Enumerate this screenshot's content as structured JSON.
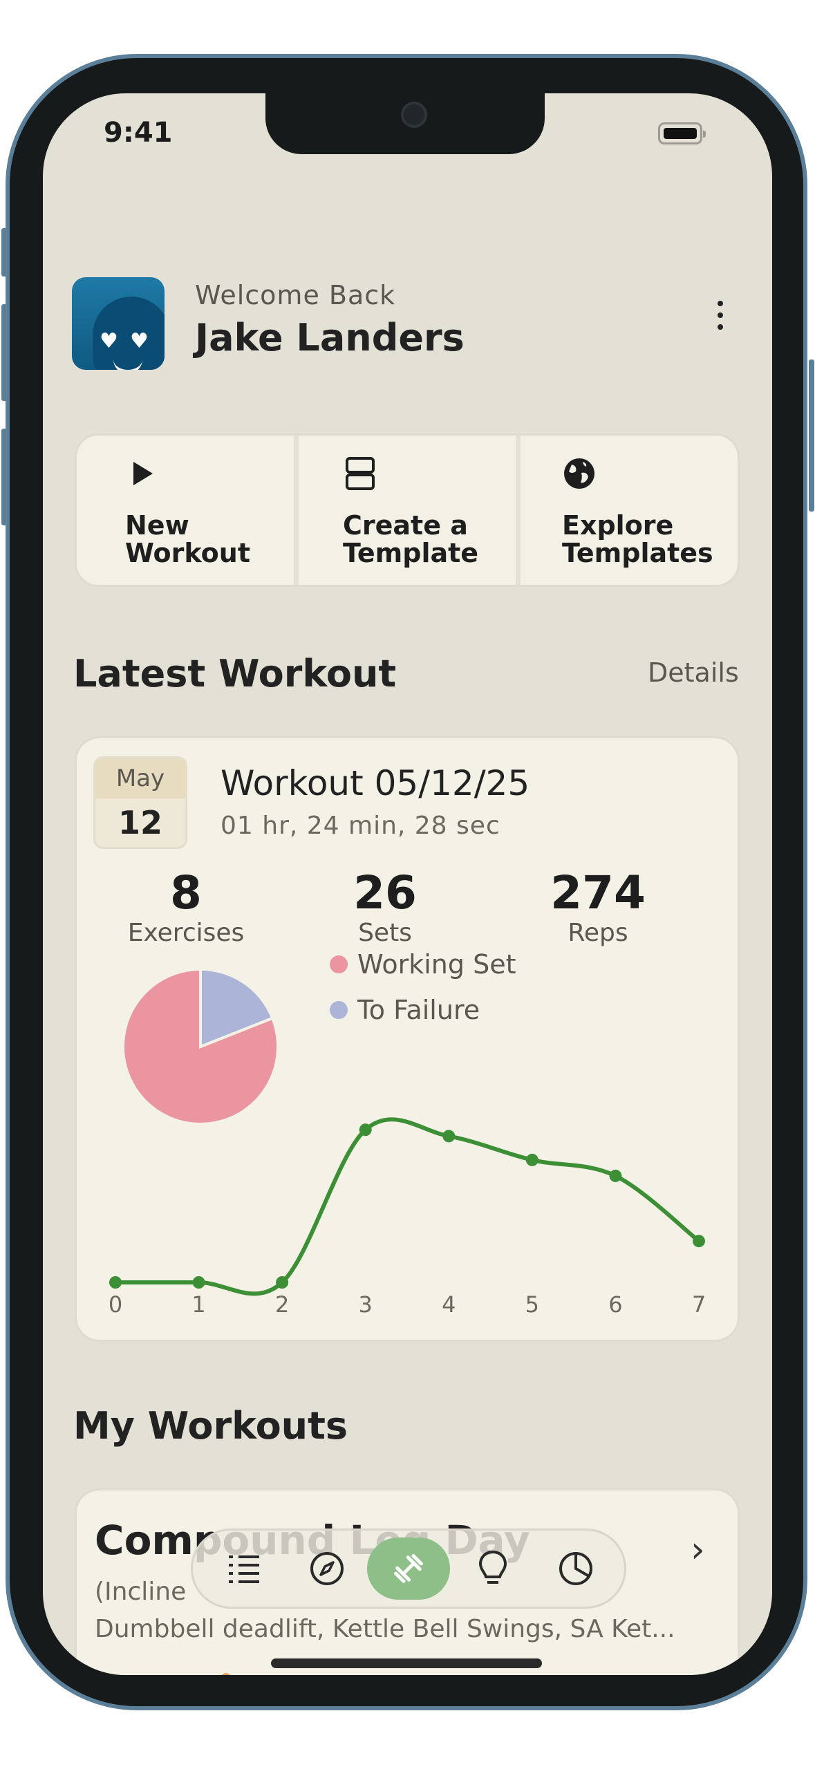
{
  "status_bar": {
    "time": "9:41"
  },
  "header": {
    "welcome": "Welcome Back",
    "name": "Jake Landers"
  },
  "quick_actions": [
    {
      "label": "New\nWorkout",
      "icon": "play-icon"
    },
    {
      "label": "Create a\nTemplate",
      "icon": "template-icon"
    },
    {
      "label": "Explore\nTemplates",
      "icon": "globe-icon"
    }
  ],
  "latest_workout": {
    "section_title": "Latest Workout",
    "details_link": "Details",
    "date_month": "May",
    "date_day": "12",
    "title": "Workout 05/12/25",
    "duration": "01 hr, 24 min, 28 sec",
    "stats": [
      {
        "value": "8",
        "label": "Exercises"
      },
      {
        "value": "26",
        "label": "Sets"
      },
      {
        "value": "274",
        "label": "Reps"
      }
    ],
    "legend": [
      {
        "label": "Working Set",
        "color": "#ea95a0"
      },
      {
        "label": "To Failure",
        "color": "#acb4d8"
      }
    ]
  },
  "chart_data": [
    {
      "type": "pie",
      "labels": [
        "Working Set",
        "To Failure"
      ],
      "values": [
        81,
        19
      ],
      "colors": [
        "#ea95a0",
        "#acb4d8"
      ]
    },
    {
      "type": "line",
      "x": [
        0,
        1,
        2,
        3,
        4,
        5,
        6,
        7
      ],
      "y": [
        0,
        0,
        0,
        0.96,
        0.92,
        0.77,
        0.67,
        0.26
      ],
      "tick_labels": [
        "0",
        "1",
        "2",
        "3",
        "4",
        "5",
        "6",
        "7"
      ],
      "color": "#3d8f35",
      "grid": false
    }
  ],
  "my_workouts": {
    "section_title": "My Workouts",
    "items": [
      {
        "title": "Compound Leg Day",
        "desc_line1": "(Incline",
        "desc_line2": "Dumbbell deadlift, Kettle Bell Swings, SA Ket..."
      }
    ]
  },
  "tabbar": {
    "items": [
      {
        "icon": "list-icon",
        "active": false
      },
      {
        "icon": "compass-icon",
        "active": false
      },
      {
        "icon": "dumbbell-icon",
        "active": true
      },
      {
        "icon": "lightbulb-icon",
        "active": false
      },
      {
        "icon": "pie-chart-icon",
        "active": false
      }
    ]
  }
}
